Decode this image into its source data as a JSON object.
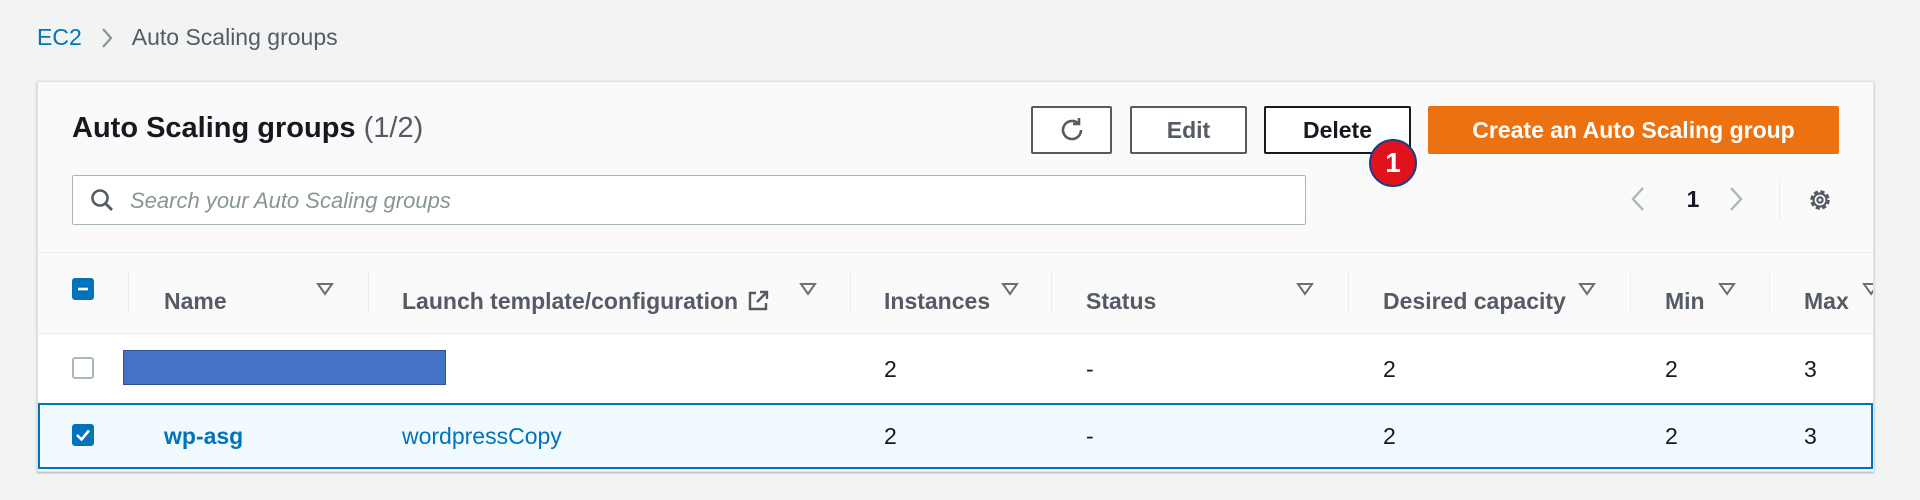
{
  "breadcrumb": {
    "root": "EC2",
    "current": "Auto Scaling groups"
  },
  "panel": {
    "title": "Auto Scaling groups",
    "count": "(1/2)"
  },
  "toolbar": {
    "edit_label": "Edit",
    "delete_label": "Delete",
    "create_label": "Create an Auto Scaling group",
    "refresh_icon": "refresh-icon"
  },
  "annotation": {
    "badge_number": "1"
  },
  "search": {
    "placeholder": "Search your Auto Scaling groups",
    "value": ""
  },
  "pagination": {
    "current_page": "1"
  },
  "table": {
    "columns": [
      "Name",
      "Launch template/configuration",
      "Instances",
      "Status",
      "Desired capacity",
      "Min",
      "Max"
    ],
    "rows": [
      {
        "selected": false,
        "name": "",
        "name_redacted": true,
        "launch_template": "",
        "instances": "2",
        "status": "-",
        "desired_capacity": "2",
        "min": "2",
        "max": "3"
      },
      {
        "selected": true,
        "name": "wp-asg",
        "name_redacted": false,
        "launch_template": "wordpressCopy",
        "instances": "2",
        "status": "-",
        "desired_capacity": "2",
        "min": "2",
        "max": "3"
      }
    ]
  },
  "colors": {
    "accent": "#0073bb",
    "primary_button": "#ec7211",
    "badge": "#e0121c",
    "redaction": "#4472c4",
    "selected_row": "#f1faff"
  }
}
